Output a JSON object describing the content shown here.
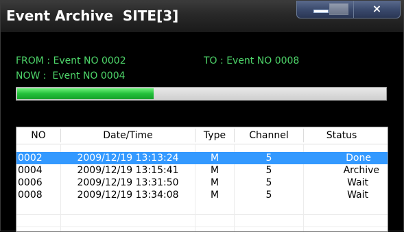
{
  "window": {
    "title": "Event Archive",
    "site": "SITE[3]",
    "close_glyph": "×"
  },
  "info": {
    "from_label": "FROM : Event NO 0002",
    "to_label": "TO : Event NO 0008",
    "now_label": "NOW :  Event NO 0004"
  },
  "progress": {
    "fraction": 0.37,
    "color": "#22c03a"
  },
  "table": {
    "columns": [
      "NO",
      "Date/Time",
      "Type",
      "Channel",
      "Status"
    ],
    "rows": [
      {
        "no": "0002",
        "datetime": "2009/12/19 13:13:24",
        "type": "M",
        "channel": "5",
        "status": "Done",
        "selected": true
      },
      {
        "no": "0004",
        "datetime": "2009/12/19 13:15:41",
        "type": "M",
        "channel": "5",
        "status": "Archive",
        "selected": false
      },
      {
        "no": "0006",
        "datetime": "2009/12/19 13:31:50",
        "type": "M",
        "channel": "5",
        "status": "Wait",
        "selected": false
      },
      {
        "no": "0008",
        "datetime": "2009/12/19 13:34:08",
        "type": "M",
        "channel": "5",
        "status": "Wait",
        "selected": false
      }
    ]
  },
  "colors": {
    "accent_text": "#4ed66a",
    "selection": "#3399ff"
  }
}
